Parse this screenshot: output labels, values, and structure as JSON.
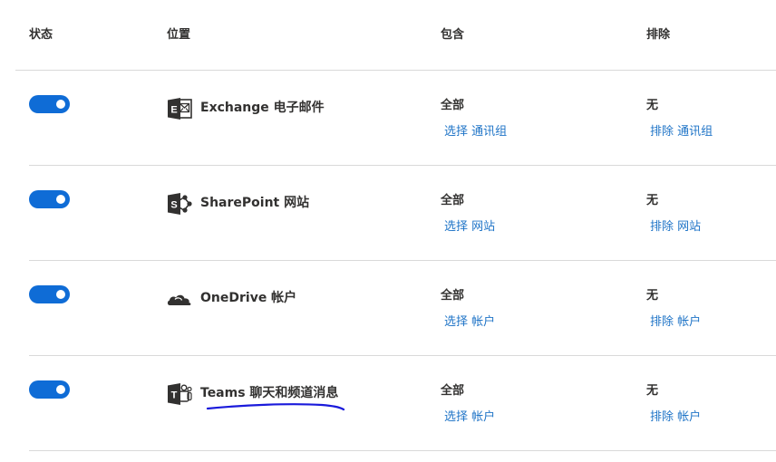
{
  "header": {
    "status": "状态",
    "location": "位置",
    "include": "包含",
    "exclude": "排除"
  },
  "rows": [
    {
      "enabled": true,
      "icon": "exchange-icon",
      "location": "Exchange 电子邮件",
      "include_value": "全部",
      "include_link": "选择 通讯组",
      "exclude_value": "无",
      "exclude_link": "排除 通讯组"
    },
    {
      "enabled": true,
      "icon": "sharepoint-icon",
      "location": "SharePoint 网站",
      "include_value": "全部",
      "include_link": "选择 网站",
      "exclude_value": "无",
      "exclude_link": "排除 网站"
    },
    {
      "enabled": true,
      "icon": "onedrive-icon",
      "location": "OneDrive 帐户",
      "include_value": "全部",
      "include_link": "选择 帐户",
      "exclude_value": "无",
      "exclude_link": "排除 帐户"
    },
    {
      "enabled": true,
      "icon": "teams-icon",
      "location": "Teams 聊天和频道消息",
      "include_value": "全部",
      "include_link": "选择 帐户",
      "exclude_value": "无",
      "exclude_link": "排除 帐户"
    }
  ],
  "colors": {
    "accent": "#0f6cd6",
    "link": "#1f74c7",
    "text": "#323130",
    "divider": "#d9d9d9",
    "annotation_ink": "#1a1adb"
  }
}
